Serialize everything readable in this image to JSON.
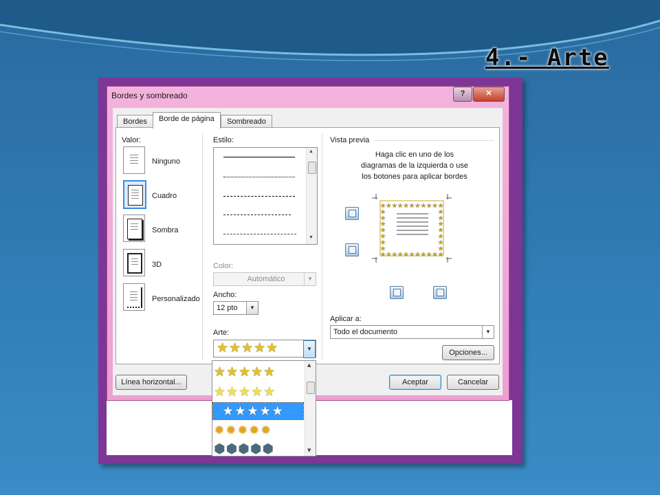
{
  "slide": {
    "title": "4.- Arte"
  },
  "dialog": {
    "title": "Bordes y sombreado",
    "help_label": "?",
    "close_label": "✕",
    "tabs": [
      {
        "label": "Bordes",
        "active": false
      },
      {
        "label": "Borde de página",
        "active": true
      },
      {
        "label": "Sombreado",
        "active": false
      }
    ],
    "setting": {
      "label": "Valor:",
      "options": [
        {
          "label": "Ninguno",
          "selected": false,
          "icon": "none-border-icon"
        },
        {
          "label": "Cuadro",
          "selected": true,
          "icon": "box-border-icon"
        },
        {
          "label": "Sombra",
          "selected": false,
          "icon": "shadow-border-icon"
        },
        {
          "label": "3D",
          "selected": false,
          "icon": "3d-border-icon"
        },
        {
          "label": "Personalizado",
          "selected": false,
          "icon": "custom-border-icon"
        }
      ]
    },
    "style": {
      "label": "Estilo:",
      "lines": [
        "solid",
        "dotted",
        "dashed-small",
        "dashed",
        "dash-dot"
      ]
    },
    "color": {
      "label": "Color:",
      "value": "Automático",
      "disabled": true
    },
    "width": {
      "label": "Ancho:",
      "value": "12 pto"
    },
    "art": {
      "label": "Arte:",
      "selected": "★★★★★",
      "options": [
        {
          "glyphs": "★★★★★",
          "color": "#e8c21a"
        },
        {
          "glyphs": "★★★★★",
          "color": "#e6d41a"
        },
        {
          "glyphs": "★★★★★",
          "color": "#111111",
          "highlighted": true
        },
        {
          "glyphs": "✹✹✹✹✹",
          "color": "#e3a323"
        },
        {
          "glyphs": "⬢⬢⬢⬢⬢",
          "color": "#4a6b7c"
        }
      ]
    },
    "preview": {
      "label": "Vista previa",
      "instructions": "Haga clic en uno de los diagramas de la izquierda o use los botones para aplicar bordes",
      "art_glyph": "★",
      "art_color": "#c9a81a"
    },
    "apply_to": {
      "label": "Aplicar a:",
      "value": "Todo el documento"
    },
    "buttons": {
      "options": "Opciones...",
      "horizontal_line": "Línea horizontal...",
      "ok": "Aceptar",
      "cancel": "Cancelar"
    }
  }
}
